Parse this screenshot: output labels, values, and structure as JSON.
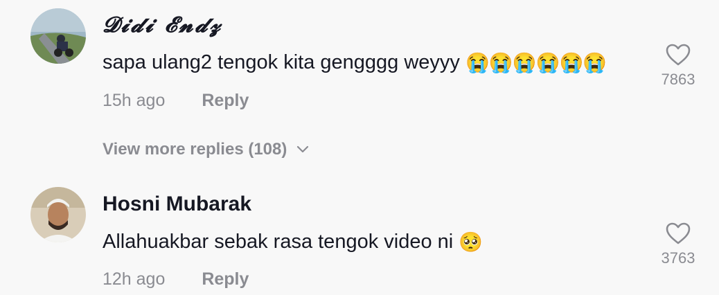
{
  "comments": [
    {
      "username": "𝓓𝓲𝓭𝓲 𝓔𝓷𝓭𝔃",
      "text": "sapa ulang2 tengok kita gengggg weyyy",
      "emojis": [
        "😭",
        "😭",
        "😭",
        "😭",
        "😭",
        "😭"
      ],
      "time": "15h ago",
      "reply_label": "Reply",
      "likes": "7863"
    },
    {
      "username": "Hosni Mubarak",
      "text": "Allahuakbar sebak rasa tengok video ni",
      "emojis": [
        "🥺"
      ],
      "time": "12h ago",
      "reply_label": "Reply",
      "likes": "3763"
    }
  ],
  "view_more_replies": "View more replies (108)",
  "icons": {
    "like": "heart-outline-icon",
    "expand": "chevron-down-icon"
  },
  "colors": {
    "background": "#f8f8f8",
    "primary_text": "#161823",
    "secondary_text": "#8a8b91"
  }
}
